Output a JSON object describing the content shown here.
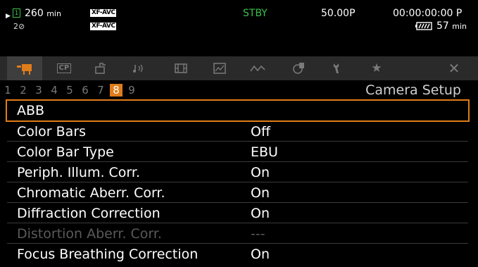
{
  "status": {
    "rec_time_value": "260",
    "rec_time_unit": "min",
    "card_slot": "1",
    "slot2_label": "2⊘",
    "format_primary": "XF-AVC",
    "format_secondary": "XF-AVC",
    "mode": "STBY",
    "frame_rate": "50.00P",
    "timecode": "00:00:00:00 P",
    "battery_value": "57",
    "battery_unit": "min"
  },
  "tabs": [
    {
      "name": "camera-tab",
      "icon": "camera-icon",
      "label": ""
    },
    {
      "name": "cp-tab",
      "icon": "cp-icon",
      "label": "CP"
    },
    {
      "name": "custom-picture-tab",
      "icon": "settings-box-icon",
      "label": ""
    },
    {
      "name": "audio-tab",
      "icon": "audio-icon",
      "label": ""
    },
    {
      "name": "recording-tab",
      "icon": "film-icon",
      "label": ""
    },
    {
      "name": "assist-tab",
      "icon": "assist-icon",
      "label": ""
    },
    {
      "name": "network-tab",
      "icon": "network-icon",
      "label": ""
    },
    {
      "name": "media-tab",
      "icon": "media-icon",
      "label": ""
    },
    {
      "name": "setup-tab",
      "icon": "wrench-icon",
      "label": ""
    },
    {
      "name": "my-menu-tab",
      "icon": "star-icon",
      "label": ""
    },
    {
      "name": "close-tab",
      "icon": "close-icon",
      "label": ""
    }
  ],
  "pages": [
    "1",
    "2",
    "3",
    "4",
    "5",
    "6",
    "7",
    "8",
    "9"
  ],
  "active_page": "8",
  "section_title": "Camera Setup",
  "menu": [
    {
      "label": "ABB",
      "value": ""
    },
    {
      "label": "Color Bars",
      "value": "Off"
    },
    {
      "label": "Color Bar Type",
      "value": "EBU"
    },
    {
      "label": "Periph. Illum. Corr.",
      "value": "On"
    },
    {
      "label": "Chromatic Aberr. Corr.",
      "value": "On"
    },
    {
      "label": "Diffraction Correction",
      "value": "On"
    },
    {
      "label": "Distortion Aberr. Corr.",
      "value": "---"
    },
    {
      "label": "Focus Breathing Correction",
      "value": "On"
    }
  ],
  "colors": {
    "accent": "#e07c1a",
    "standby": "#39c04a"
  }
}
